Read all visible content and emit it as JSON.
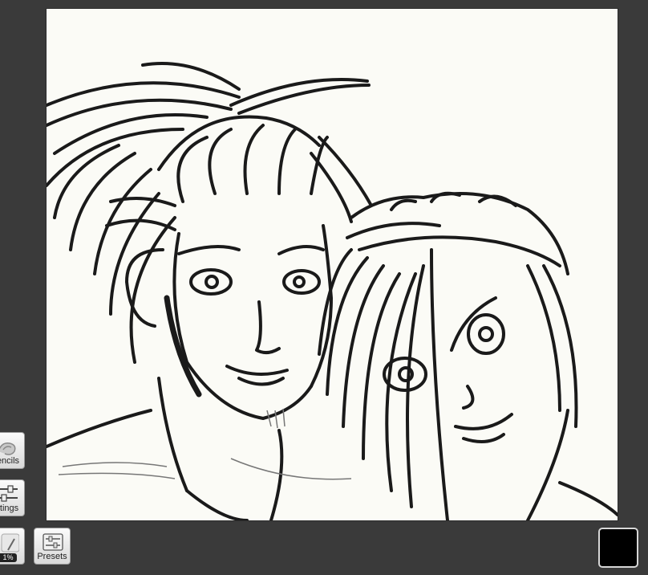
{
  "canvas": {
    "artwork": "pencil-sketch",
    "background_color": "#fbfbf6"
  },
  "left_toolbar": {
    "stencils_label": "encils",
    "settings_label": "ttings",
    "brush_size": "1%"
  },
  "bottom_toolbar": {
    "presets_label": "Presets",
    "current_color": "#000000"
  },
  "icons": {
    "stencils": "stencil-icon",
    "settings": "sliders-icon",
    "brush": "pencil-brush-icon",
    "presets": "presets-icon"
  }
}
